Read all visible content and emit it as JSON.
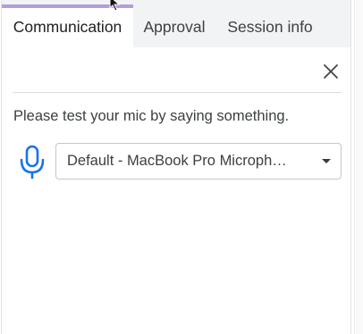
{
  "tabs": [
    {
      "label": "Communication",
      "active": true
    },
    {
      "label": "Approval",
      "active": false
    },
    {
      "label": "Session info",
      "active": false
    }
  ],
  "close_icon": "close-icon",
  "mic_test": {
    "instruction": "Please test your mic by saying something.",
    "mic_icon": "microphone-icon",
    "device_select": {
      "selected": "Default - MacBook Pro Microph…"
    }
  },
  "colors": {
    "tab_indicator": "#b39ddb",
    "mic_icon": "#1a73e8",
    "tabbar_bg": "#f1f3f4"
  }
}
